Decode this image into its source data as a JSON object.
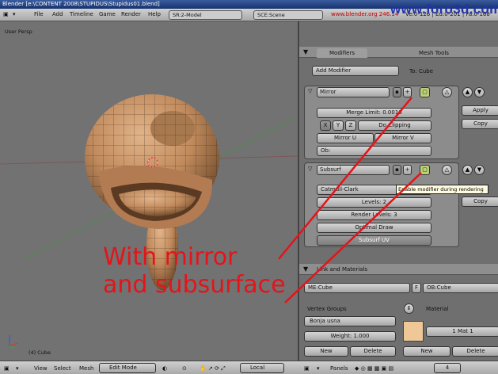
{
  "window": {
    "title": "Blender [e:\\CONTENT 2008\\STUPIDUS\\Stupidus01.blend]"
  },
  "topbar": {
    "menus": [
      "File",
      "Add",
      "Timeline",
      "Game",
      "Render",
      "Help"
    ],
    "screen": "SR:2-Model",
    "scene": "SCE:Scene",
    "site": "www.blender.org 246.14",
    "stats": "Ve:0-126 | Ed:0-201 | Fa:0-168"
  },
  "watermark": "www.foro3d.com",
  "viewport": {
    "label": "User Persp",
    "object": "(4) Cube"
  },
  "panel": {
    "tabs": [
      "Modifiers",
      "Mesh Tools"
    ],
    "add_modifier": "Add Modifier",
    "to": "To: Cube",
    "mirror": {
      "name": "Mirror",
      "merge": "Merge Limit: 0.0010",
      "x": "X",
      "y": "Y",
      "z": "Z",
      "clip": "Do Clipping",
      "u": "Mirror U",
      "v": "Mirror V",
      "ob": "Ob:"
    },
    "apply": "Apply",
    "copy": "Copy",
    "subsurf": {
      "name": "Subsurf",
      "type": "Catmull-Clark",
      "levels": "Levels: 2",
      "render": "Render Levels: 3",
      "optimal": "Optimal Draw",
      "uv": "Subsurf UV"
    },
    "copy2": "Copy",
    "tooltip": "Enable modifier during rendering",
    "links": {
      "title": "Link and Materials",
      "me": "ME:Cube",
      "f": "F",
      "ob": "OB:Cube",
      "vg": "Vertex Groups",
      "material": "Material",
      "group": "Bonja usna",
      "weight": "Weight: 1.000",
      "mat": "1 Mat 1",
      "new": "New",
      "delete": "Delete"
    }
  },
  "bottombar": {
    "menus": [
      "View",
      "Select",
      "Mesh"
    ],
    "mode": "Edit Mode",
    "pivot": "Local",
    "panels": "Panels",
    "frame": "4"
  },
  "annotation": [
    "With mirror",
    "and subsurface"
  ],
  "colors": {
    "annotation": "#e4141a",
    "mesh": "#c8966a",
    "panel": "#6f6f6f"
  }
}
